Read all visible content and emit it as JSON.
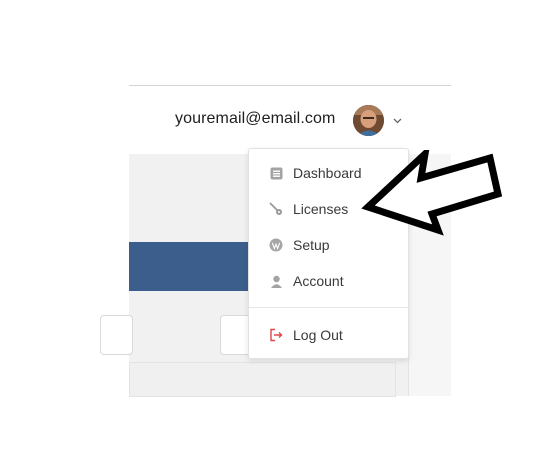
{
  "header": {
    "email": "youremail@email.com",
    "avatar_icon": "avatar-photo",
    "caret_icon": "chevron-down-icon"
  },
  "menu": {
    "items": [
      {
        "label": "Dashboard",
        "icon": "dashboard-icon"
      },
      {
        "label": "Licenses",
        "icon": "key-icon"
      },
      {
        "label": "Setup",
        "icon": "wordpress-icon"
      },
      {
        "label": "Account",
        "icon": "user-icon"
      }
    ],
    "logout": {
      "label": "Log Out",
      "icon": "logout-icon"
    }
  },
  "colors": {
    "banner": "#3b5e8d",
    "icon_gray": "#9a9a9a",
    "logout_icon": "#e04848"
  }
}
